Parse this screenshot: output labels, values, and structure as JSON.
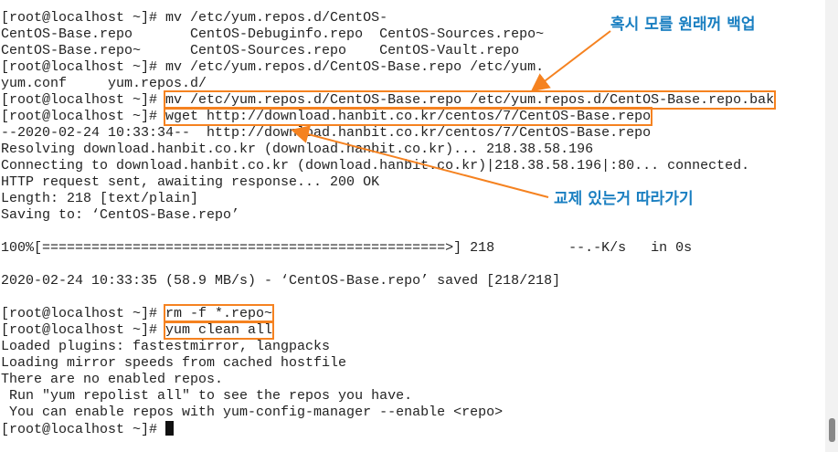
{
  "terminal": {
    "prompt": "[root@localhost ~]# ",
    "lines": [
      {
        "type": "cmd",
        "text": "mv /etc/yum.repos.d/CentOS-"
      },
      {
        "type": "out",
        "text": "CentOS-Base.repo       CentOS-Debuginfo.repo  CentOS-Sources.repo~"
      },
      {
        "type": "out",
        "text": "CentOS-Base.repo~      CentOS-Sources.repo    CentOS-Vault.repo"
      },
      {
        "type": "cmd",
        "text": "mv /etc/yum.repos.d/CentOS-Base.repo /etc/yum."
      },
      {
        "type": "out",
        "text": "yum.conf     yum.repos.d/"
      },
      {
        "type": "cmd",
        "text": "mv /etc/yum.repos.d/CentOS-Base.repo /etc/yum.repos.d/CentOS-Base.repo.bak",
        "highlight": true
      },
      {
        "type": "cmd",
        "text": "wget http://download.hanbit.co.kr/centos/7/CentOS-Base.repo",
        "highlight": true
      },
      {
        "type": "out",
        "text": "--2020-02-24 10:33:34--  http://download.hanbit.co.kr/centos/7/CentOS-Base.repo"
      },
      {
        "type": "out",
        "text": "Resolving download.hanbit.co.kr (download.hanbit.co.kr)... 218.38.58.196"
      },
      {
        "type": "out",
        "text": "Connecting to download.hanbit.co.kr (download.hanbit.co.kr)|218.38.58.196|:80... connected."
      },
      {
        "type": "out",
        "text": "HTTP request sent, awaiting response... 200 OK"
      },
      {
        "type": "out",
        "text": "Length: 218 [text/plain]"
      },
      {
        "type": "out",
        "text": "Saving to: ‘CentOS-Base.repo’"
      },
      {
        "type": "out",
        "text": ""
      },
      {
        "type": "out",
        "text": "100%[=================================================>] 218         --.-K/s   in 0s"
      },
      {
        "type": "out",
        "text": ""
      },
      {
        "type": "out",
        "text": "2020-02-24 10:33:35 (58.9 MB/s) - ‘CentOS-Base.repo’ saved [218/218]"
      },
      {
        "type": "out",
        "text": ""
      },
      {
        "type": "cmd",
        "text": "rm -f *.repo~",
        "highlight": true
      },
      {
        "type": "cmd",
        "text": "yum clean all",
        "highlight": true
      },
      {
        "type": "out",
        "text": "Loaded plugins: fastestmirror, langpacks"
      },
      {
        "type": "out",
        "text": "Loading mirror speeds from cached hostfile"
      },
      {
        "type": "out",
        "text": "There are no enabled repos."
      },
      {
        "type": "out",
        "text": " Run \"yum repolist all\" to see the repos you have."
      },
      {
        "type": "out",
        "text": " You can enable repos with yum-config-manager --enable <repo>"
      },
      {
        "type": "cmd",
        "text": "",
        "cursor": true
      }
    ]
  },
  "annotations": {
    "backup_note": "혹시 모를 원래꺼 백업",
    "replace_note": "교제 있는거 따라가기"
  },
  "colors": {
    "highlight": "#f58220",
    "note": "#1a7fc1"
  }
}
